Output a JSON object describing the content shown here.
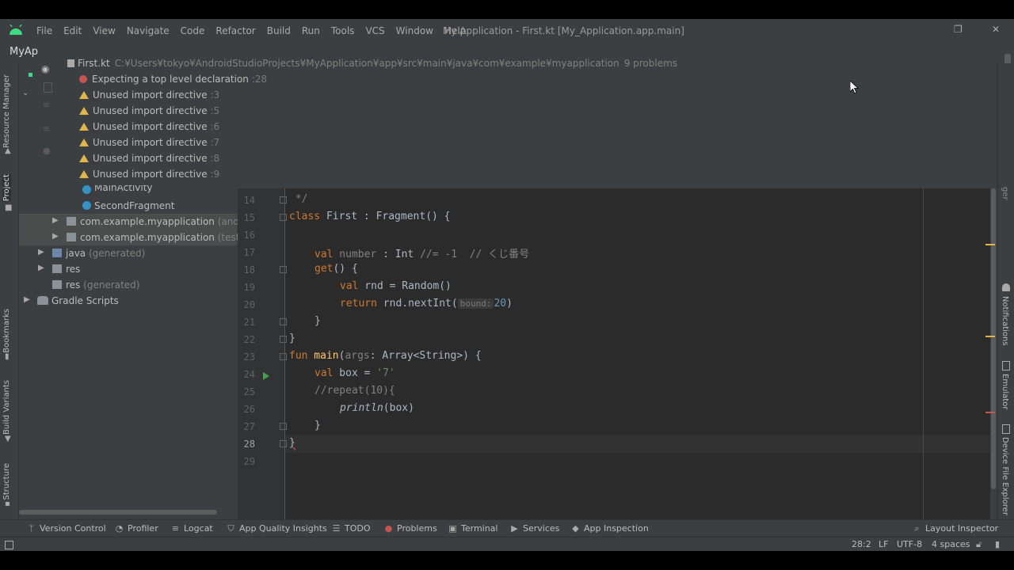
{
  "menubar": {
    "items": [
      "File",
      "Edit",
      "View",
      "Navigate",
      "Code",
      "Refactor",
      "Build",
      "Run",
      "Tools",
      "VCS",
      "Window",
      "Help"
    ],
    "window_title": "My Application - First.kt [My_Application.app.main]"
  },
  "project": {
    "title": "MyAp"
  },
  "left_tabs": [
    "Resource Manager",
    "Project",
    "Bookmarks",
    "Build Variants",
    "Structure"
  ],
  "right_tabs": [
    "Notifications",
    "Emulator",
    "Device File Explorer"
  ],
  "right_tab_partial": "ger",
  "problems": {
    "file": "First.kt",
    "path": "C:¥Users¥tokyo¥AndroidStudioProjects¥MyApplication¥app¥src¥main¥java¥com¥example¥myapplication",
    "count": "9 problems",
    "items": [
      {
        "type": "error",
        "text": "Expecting a top level declaration",
        "line": ":28"
      },
      {
        "type": "warning",
        "text": "Unused import directive",
        "line": ":3"
      },
      {
        "type": "warning",
        "text": "Unused import directive",
        "line": ":5"
      },
      {
        "type": "warning",
        "text": "Unused import directive",
        "line": ":6"
      },
      {
        "type": "warning",
        "text": "Unused import directive",
        "line": ":7"
      },
      {
        "type": "warning",
        "text": "Unused import directive",
        "line": ":8"
      },
      {
        "type": "warning",
        "text": "Unused import directive",
        "line": ":9"
      }
    ]
  },
  "tree": {
    "rows": [
      {
        "label": "MainActivity",
        "suffix": ""
      },
      {
        "label": "SecondFragment",
        "suffix": ""
      },
      {
        "label": "com.example.myapplication",
        "suffix": "(androidTest)"
      },
      {
        "label": "com.example.myapplication",
        "suffix": "(test)"
      },
      {
        "label": "java",
        "suffix": "(generated)"
      },
      {
        "label": "res",
        "suffix": ""
      },
      {
        "label": "res",
        "suffix": "(generated)"
      },
      {
        "label": "Gradle Scripts",
        "suffix": ""
      }
    ]
  },
  "editor": {
    "line_numbers": [
      "14",
      "15",
      "16",
      "17",
      "18",
      "19",
      "20",
      "21",
      "22",
      "23",
      "24",
      "25",
      "26",
      "27",
      "28",
      "29"
    ],
    "current_line": "28",
    "code": {
      "l14": " */",
      "l15_kw": "class",
      "l15_rest": " First : Fragment() {",
      "l17_kw": "val",
      "l17_prop": " number",
      "l17_rest": " : Int ",
      "l17_cm": "//= -1  // くじ番号",
      "l18_fn": "get",
      "l18_rest": "() {",
      "l19_kw": "val",
      "l19_rest": " rnd = Random()",
      "l20_kw": "return",
      "l20_rest": " rnd.nextInt(",
      "l20_hint": "bound:",
      "l20_num": "20",
      "l20_end": ")",
      "l21": "}",
      "l22": "}",
      "l23_kw": "fun",
      "l23_fn": " main",
      "l23_open": "(",
      "l23_arg": "args",
      "l23_rest": ": Array<String>) {",
      "l24_kw": "val",
      "l24_rest": " box = ",
      "l24_str": "'7'",
      "l25_cm": "//repeat(10){",
      "l26_fn": "println",
      "l26_rest": "(box)",
      "l27": "}",
      "l28": "}"
    }
  },
  "toolbar": {
    "items": [
      "Version Control",
      "Profiler",
      "Logcat",
      "App Quality Insights",
      "TODO",
      "Problems",
      "Terminal",
      "Services",
      "App Inspection"
    ],
    "layout_inspector": "Layout Inspector"
  },
  "statusbar": {
    "position": "28:2",
    "line_sep": "LF",
    "encoding": "UTF-8",
    "indent": "4 spaces"
  },
  "colors": {
    "error": "#c75450",
    "warning": "#e0b64a",
    "keyword": "#cc7832",
    "function": "#ffc66d",
    "comment": "#808080",
    "string": "#6a8759",
    "number": "#6897bb"
  }
}
